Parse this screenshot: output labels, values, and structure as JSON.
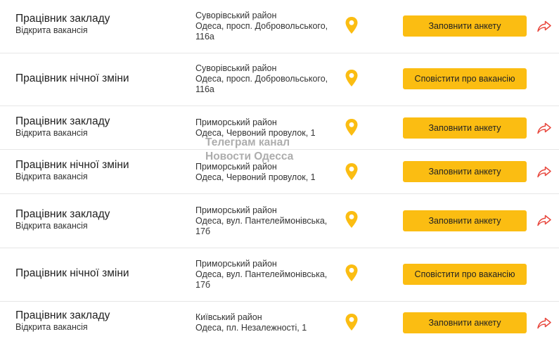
{
  "jobs": [
    {
      "title": "Працівник закладу",
      "status": "Відкрита вакансія",
      "district": "Суворівський район",
      "address": [
        "Одеса, просп. Добровольського,",
        "116а"
      ],
      "button": "Заповнити анкету",
      "share": true
    },
    {
      "title": "Працівник нічної зміни",
      "status": "",
      "district": "Суворівський район",
      "address": [
        "Одеса, просп. Добровольського,",
        "116а"
      ],
      "button": "Сповістити про вакансію",
      "share": false
    },
    {
      "title": "Працівник закладу",
      "status": "Відкрита вакансія",
      "district": "Приморський район",
      "address": [
        "Одеса, Червоний провулок, 1",
        ""
      ],
      "button": "Заповнити анкету",
      "share": true
    },
    {
      "title": "Працівник нічної зміни",
      "status": "Відкрита вакансія",
      "district": "Приморський район",
      "address": [
        "Одеса, Червоний провулок, 1",
        ""
      ],
      "button": "Заповнити анкету",
      "share": true
    },
    {
      "title": "Працівник закладу",
      "status": "Відкрита вакансія",
      "district": "Приморський район",
      "address": [
        "Одеса, вул. Пантелеймонівська,",
        "17б"
      ],
      "button": "Заповнити анкету",
      "share": true
    },
    {
      "title": "Працівник нічної зміни",
      "status": "",
      "district": "Приморський район",
      "address": [
        "Одеса, вул. Пантелеймонівська,",
        "17б"
      ],
      "button": "Сповістити про вакансію",
      "share": false
    },
    {
      "title": "Працівник закладу",
      "status": "Відкрита вакансія",
      "district": "Київський район",
      "address": [
        "Одеса, пл. Незалежності, 1",
        ""
      ],
      "button": "Заповнити анкету",
      "share": true
    }
  ],
  "watermark": [
    "Телеграм канал",
    "Новости Одесса"
  ],
  "icons": {
    "location": "map-pin-icon",
    "share": "share-arrow-icon"
  },
  "colors": {
    "accent": "#fbbd12",
    "share_icon": "#e8473d",
    "pin": "#fbbd12"
  }
}
